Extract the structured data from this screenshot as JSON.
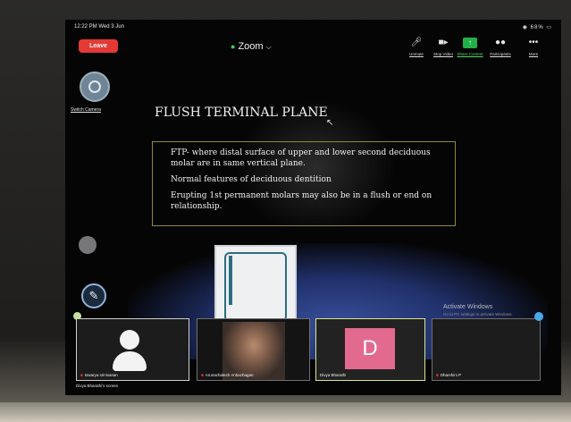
{
  "status_bar": {
    "time": "12:22 PM  Wed 3 Jun",
    "battery": "68%"
  },
  "header": {
    "leave_label": "Leave",
    "title": "Zoom",
    "shield_icon": "shield-check-icon",
    "toolbar": [
      {
        "icon": "mic-muted-icon",
        "label": "Unmute"
      },
      {
        "icon": "video-icon",
        "label": "Stop Video"
      },
      {
        "icon": "share-screen-icon",
        "label": "Share Content"
      },
      {
        "icon": "participants-icon",
        "label": "Participants"
      },
      {
        "icon": "more-icon",
        "label": "More"
      }
    ]
  },
  "left_controls": {
    "switch_camera_label": "Switch Camera"
  },
  "slide": {
    "title": "FLUSH TERMINAL PLANE",
    "bullets": [
      "FTP- where distal surface of upper and lower second deciduous molar are in same vertical plane.",
      "Normal features of deciduous dentition",
      "Erupting 1st permanent  molars may also be in a flush or end on relationship."
    ]
  },
  "watermark": {
    "title": "Activate Windows",
    "subtitle": "Go to PC settings to activate Windows."
  },
  "participants": [
    {
      "name": "Iswarya srinivasan",
      "kind": "avatar"
    },
    {
      "name": "Arunachalesh Anbazhagan",
      "kind": "video"
    },
    {
      "name": "Divya Bharathi",
      "kind": "letter",
      "letter": "D"
    },
    {
      "name": "Dharshini P",
      "kind": "empty"
    }
  ],
  "screen_owner": "Divya Bharathi's screen",
  "colors": {
    "leave": "#e53935",
    "share": "#23b04a",
    "accent_pin": "#4aa8e8"
  }
}
